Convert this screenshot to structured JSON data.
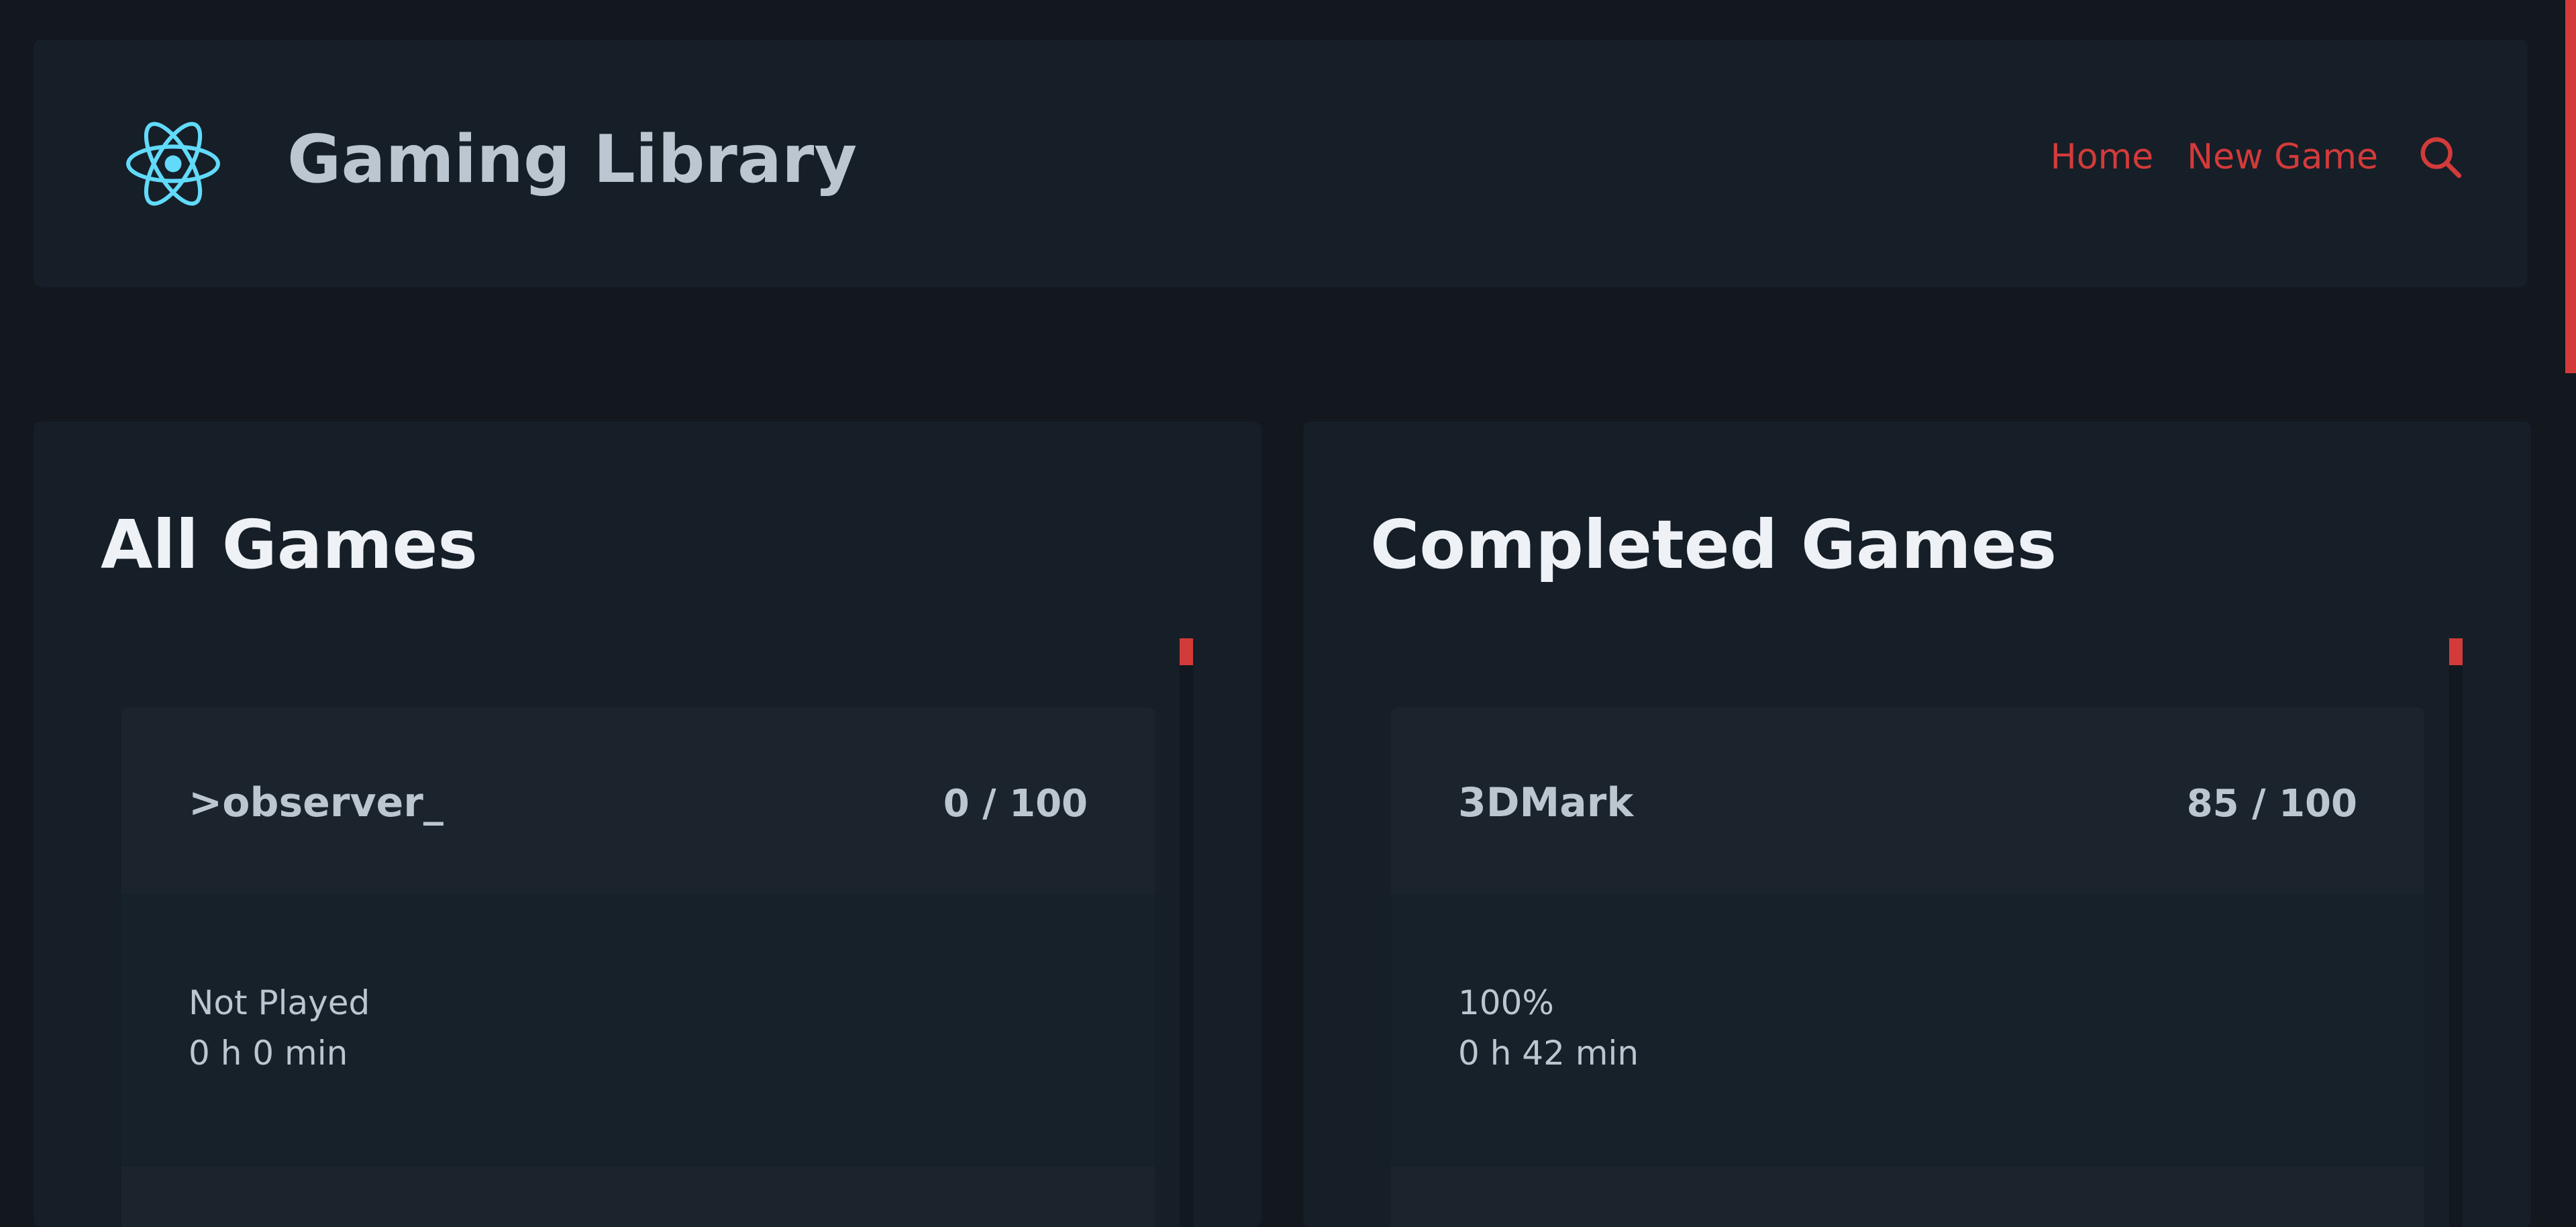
{
  "header": {
    "title": "Gaming Library",
    "logo_icon": "react-atom-icon",
    "nav": {
      "home_label": "Home",
      "new_game_label": "New Game",
      "search_icon": "search-icon"
    }
  },
  "colors": {
    "background": "#12181e",
    "panel": "#161f27",
    "accent": "#d33a3a",
    "logo": "#61dafb",
    "text": "#bcc6d0",
    "heading": "#eef2f6"
  },
  "panels": [
    {
      "title": "All Games",
      "games": [
        {
          "name": ">observer_",
          "score": "0 / 100",
          "status": "Not Played",
          "playtime": "0 h 0 min"
        }
      ]
    },
    {
      "title": "Completed Games",
      "games": [
        {
          "name": "3DMark",
          "score": "85 / 100",
          "status": "100%",
          "playtime": "0 h 42 min"
        }
      ]
    }
  ]
}
